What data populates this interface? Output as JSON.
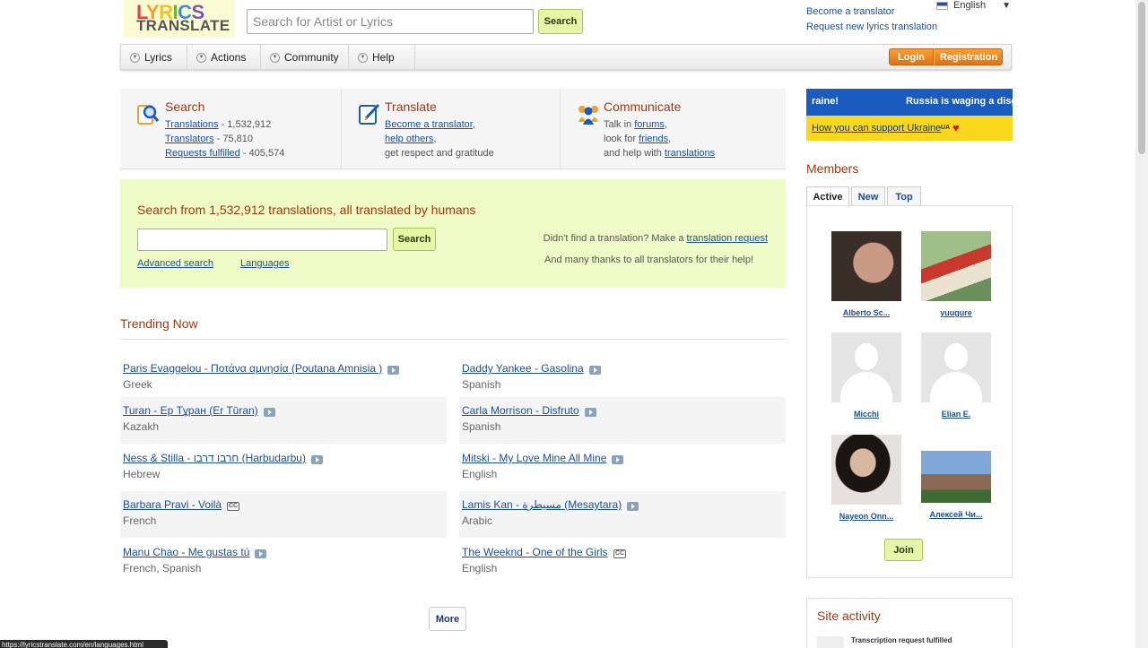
{
  "header": {
    "logo_line1": "LYRICS",
    "logo_line2": "TRANSLATE",
    "search_placeholder": "Search for Artist or Lyrics",
    "search_button": "Search",
    "become_translator": "Become a translator",
    "request_translation": "Request new lyrics translation",
    "language": "English"
  },
  "nav": {
    "items": [
      "Lyrics",
      "Actions",
      "Community",
      "Help"
    ],
    "login": "Login",
    "registration": "Registration"
  },
  "features": {
    "search": {
      "title": "Search",
      "translations_label": "Translations",
      "translations_count": " - 1,532,912",
      "translators_label": "Translators",
      "translators_count": " - 75,810",
      "requests_label": "Requests fulfilled",
      "requests_count": " - 405,574"
    },
    "translate": {
      "title": "Translate",
      "become": "Become a translator",
      "help": "help others",
      "respect": "get respect and gratitude"
    },
    "communicate": {
      "title": "Communicate",
      "talk_prefix": "Talk in ",
      "forums": "forums",
      "look_prefix": "look for ",
      "friends": "friends",
      "help_prefix": "and help with ",
      "translations": "translations"
    }
  },
  "search_panel": {
    "heading": "Search from 1,532,912 translations, all translated by humans",
    "button": "Search",
    "advanced": "Advanced search",
    "languages": "Languages",
    "notice_prefix": "Didn't find a translation? Make a ",
    "notice_link": "translation request",
    "thanks": "And many thanks to all translators for their help!"
  },
  "trending": {
    "title": "Trending Now",
    "items": [
      {
        "title": "Paris Evaggelou - Ποτάνα αμνησία (Poutana Amnisia )",
        "lang": "Greek",
        "badge": "video"
      },
      {
        "title": "Daddy Yankee - Gasolina",
        "lang": "Spanish",
        "badge": "video"
      },
      {
        "title": "Turan - Ер Тұран (Er Tūran)",
        "lang": "Kazakh",
        "badge": "video"
      },
      {
        "title": "Carla Morrison - Disfruto",
        "lang": "Spanish",
        "badge": "video"
      },
      {
        "title": "Ness & Stilla - חרבו דרבו (Harbudarbu)",
        "lang": "Hebrew",
        "badge": "video"
      },
      {
        "title": "Mitski - My Love Mine All Mine",
        "lang": "English",
        "badge": "video"
      },
      {
        "title": "Barbara Pravi - Voilà",
        "lang": "French",
        "badge": "cc"
      },
      {
        "title": "Lamis Kan - مسيطرة (Mesaytara)",
        "lang": "Arabic",
        "badge": "video"
      },
      {
        "title": "Manu Chao - Me gustas tú",
        "lang": "French, Spanish",
        "badge": "video"
      },
      {
        "title": "The Weeknd - One of the Girls",
        "lang": "English",
        "badge": "cc"
      }
    ],
    "more": "More"
  },
  "ukraine": {
    "banner_left": "raine!",
    "banner_right": "Russia is waging a disg",
    "support_link": "How you can support Ukraine",
    "ua_badge": "UA",
    "heart": "♥"
  },
  "members": {
    "title": "Members",
    "tabs": [
      "Active",
      "New",
      "Top"
    ],
    "list": [
      {
        "name": "Alberto Sc...",
        "avatar": "photo-man"
      },
      {
        "name": "yuugure",
        "avatar": "artwork"
      },
      {
        "name": "Micchi",
        "avatar": "placeholder"
      },
      {
        "name": "Elian E.",
        "avatar": "placeholder"
      },
      {
        "name": "Nayeon Onn...",
        "avatar": "photo-woman"
      },
      {
        "name": "Алексей Чи...",
        "avatar": "photo-church"
      }
    ],
    "join": "Join"
  },
  "site_activity": {
    "title": "Site activity",
    "first_item": "Transcription request fulfilled"
  },
  "status_bar": {
    "url": "https://lyricstranslate.com/en/languages.html"
  },
  "colors": {
    "accent_title": "#a3380f",
    "link": "#1a4fa0",
    "panel_bg": "#eefbc7",
    "login_orange": "#e0730f",
    "ukraine_blue": "#1a5bbf",
    "ukraine_yellow": "#f9d81b"
  }
}
